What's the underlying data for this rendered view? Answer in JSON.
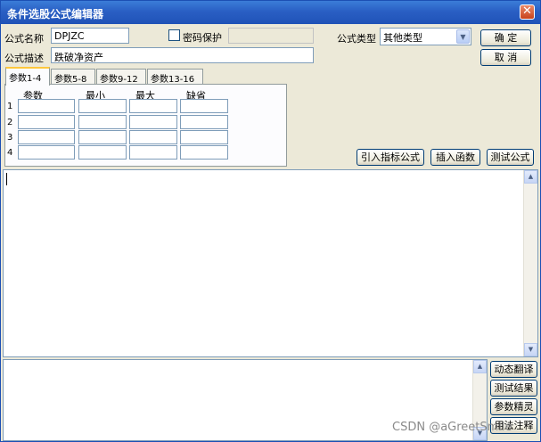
{
  "window": {
    "title": "条件选股公式编辑器"
  },
  "form": {
    "name_label": "公式名称",
    "name_value": "DPJZC",
    "password_label": "密码保护",
    "password_value": "",
    "type_label": "公式类型",
    "type_value": "其他类型",
    "desc_label": "公式描述",
    "desc_value": "跌破净资产"
  },
  "buttons": {
    "ok": "确 定",
    "cancel": "取 消"
  },
  "tabs": [
    "参数1-4",
    "参数5-8",
    "参数9-12",
    "参数13-16"
  ],
  "params": {
    "columns": [
      "参数",
      "最小",
      "最大",
      "缺省"
    ],
    "rows": [
      "1",
      "2",
      "3",
      "4"
    ]
  },
  "toolbar": {
    "import": "引入指标公式",
    "insert": "插入函数",
    "test": "测试公式"
  },
  "side_buttons": [
    "动态翻译",
    "测试结果",
    "参数精灵",
    "用法注释"
  ],
  "watermark": "CSDN @aGreetSmile",
  "icons": {
    "close": "close-icon",
    "dropdown": "chevron-down-icon",
    "scroll_up": "arrow-up-icon",
    "scroll_down": "arrow-down-icon"
  }
}
